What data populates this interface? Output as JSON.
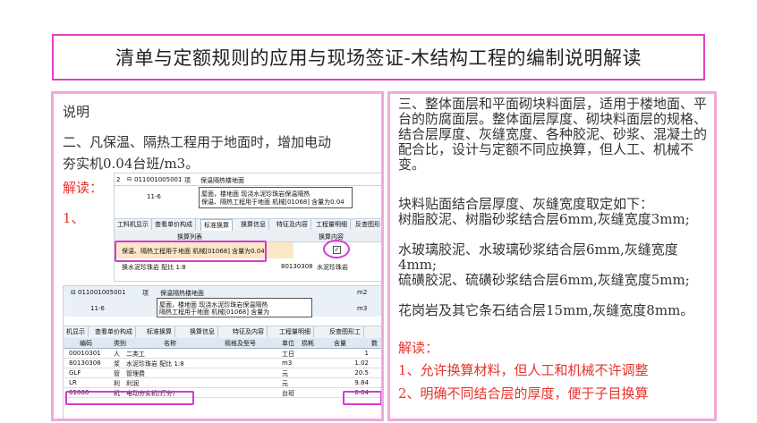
{
  "title": "清单与定额规则的应用与现场签证-木结构工程的编制说明解读",
  "left": {
    "heading": "说明",
    "para_line1": "二、凡保温、隔热工程用于地面时，增加电动",
    "para_line2": "夯实机0.04台班/m3。",
    "jiedu": "解读：",
    "item1": "1、"
  },
  "shot1": {
    "row_num": "2",
    "code": "011001005001",
    "type": "项",
    "name": "保温隔热楼地面",
    "sub_code": "11-6",
    "sub_desc1": "屋面，楼地面 现浇水泥珍珠岩保温隔热",
    "sub_desc2": "保温、隔热工程用于地面 机械[01068] 含量为0.04",
    "tabs": [
      "工料机显示",
      "查看单价构成",
      "标准换算",
      "换算信息",
      "特征及内容",
      "工程量明细",
      "反查图形"
    ],
    "col_list": "换算列表",
    "col_content": "换算内容",
    "list_item": "保温、隔热工程用于地面 机械[01068] 含量为0.04",
    "check": "✓",
    "bottom_text": "换水泥珍珠岩 配比 1:8",
    "bottom_code": "80130308",
    "bottom_name": "水泥珍珠岩"
  },
  "shot2": {
    "code": "011001005001",
    "type": "项",
    "name": "保温隔热楼地面",
    "unit": "m2",
    "sub_code": "11-6",
    "sub_desc1": "屋面，楼地面 现浇水泥珍珠岩保温隔热",
    "sub_desc2": "隔热工程用于地面 机械[01068] 含量为",
    "sub_unit": "m3",
    "tabs": [
      "机显示",
      "查看单价构成",
      "标准换算",
      "换算信息",
      "特征及内容",
      "工程量明细",
      "反查图形工"
    ],
    "headers": [
      "编码",
      "类别",
      "名称",
      "规格及型号",
      "单位",
      "损耗",
      "含量",
      "数"
    ],
    "rows": [
      [
        "00010301",
        "人",
        "二类工",
        "",
        "工日",
        "",
        "1",
        ""
      ],
      [
        "80130308",
        "浆",
        "水泥珍珠岩 配比 1:8",
        "",
        "m3",
        "",
        "1.02",
        ""
      ],
      [
        "GLF",
        "管",
        "管理费",
        "",
        "元",
        "",
        "20.5",
        ""
      ],
      [
        "LR",
        "利",
        "利润",
        "",
        "元",
        "",
        "9.84",
        ""
      ],
      [
        "01068",
        "机",
        "电动夯实机(打夯)",
        "",
        "台班",
        "",
        "0.04",
        ""
      ]
    ]
  },
  "right": {
    "p1": "三、整体面层和平面砌块料面层，适用于楼地面、平台的防腐面层。整体面层厚度、砌块料面层的规格、结合层厚度、灰缝宽度、各种胶泥、砂浆、混凝土的配合比，设计与定额不同应换算，但人工、机械不变。",
    "p2": "块料贴面结合层厚度、灰缝宽度取定如下：",
    "p3": "树脂胶泥、树脂砂浆结合层6mm,灰缝宽度3mm;",
    "p4": "水玻璃胶泥、水玻璃砂浆结合层6mm,灰缝宽度4mm;",
    "p5": "硫磺胶泥、硫磺砂浆结合层6mm,灰缝宽度5mm;",
    "p6": "花岗岩及其它条石结合层15mm,灰缝宽度8mm。",
    "jiedu": "解读：",
    "r1": "1、允许换算材料，但人工和机械不许调整",
    "r2": "2、明确不同结合层的厚度，便于子目换算"
  },
  "colors": {
    "title_border": "#e040c8",
    "panel_border": "#f2a8d8",
    "red": "#e8322b",
    "highlight": "#d63ad2"
  }
}
